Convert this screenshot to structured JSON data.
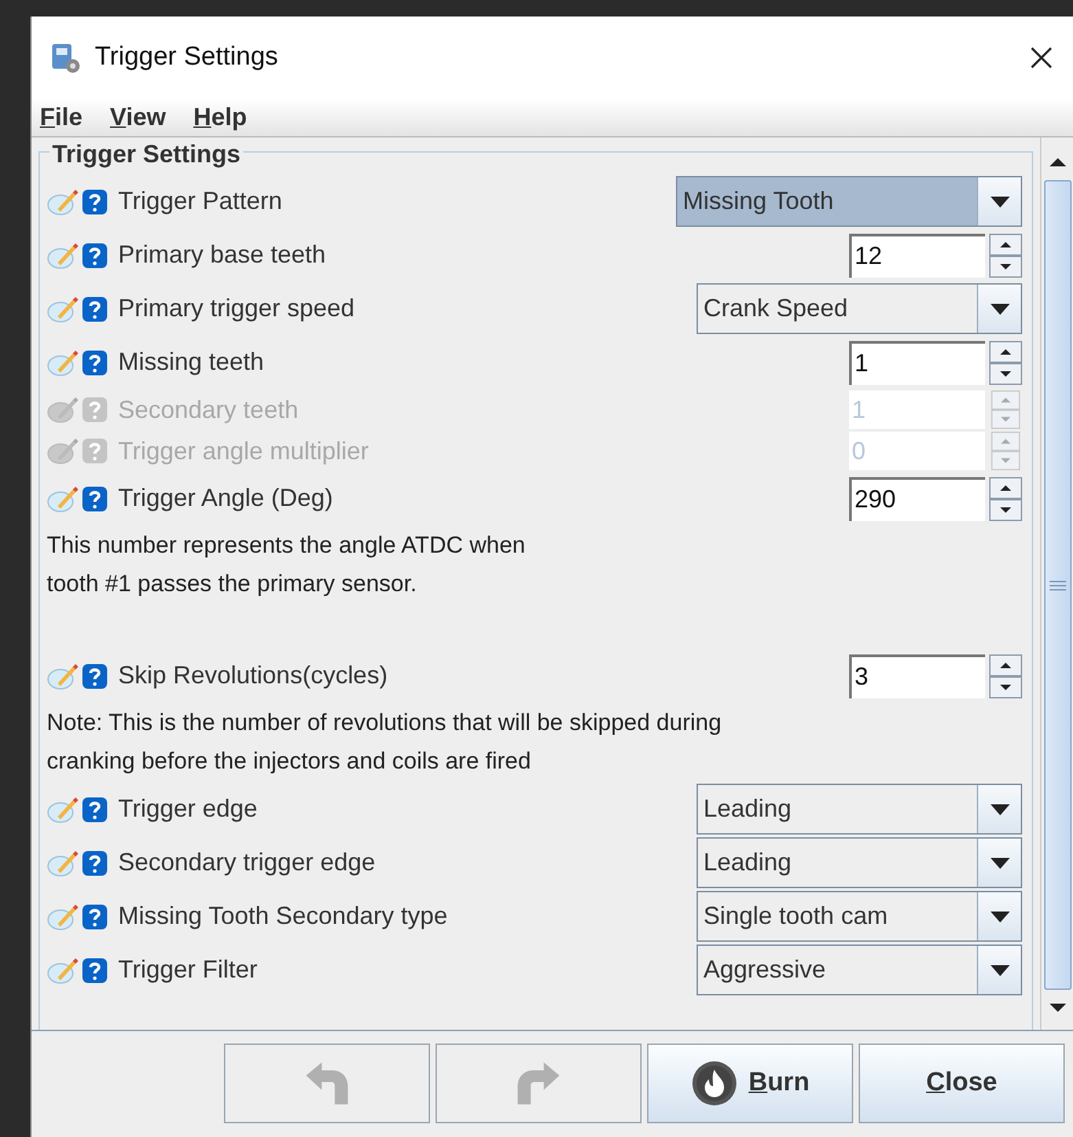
{
  "window": {
    "title": "Trigger Settings"
  },
  "menu": [
    "File",
    "View",
    "Help"
  ],
  "panel": {
    "title": "Trigger Settings",
    "rows": [
      {
        "kind": "combo",
        "label": "Trigger Pattern",
        "value": "Missing Tooth",
        "disabled": false,
        "focused": true
      },
      {
        "kind": "spinner",
        "label": "Primary base teeth",
        "value": "12",
        "disabled": false
      },
      {
        "kind": "combo",
        "label": "Primary trigger speed",
        "value": "Crank Speed",
        "disabled": false,
        "focused": false
      },
      {
        "kind": "spinner",
        "label": "Missing teeth",
        "value": "1",
        "disabled": false
      },
      {
        "kind": "spinner",
        "label": "Secondary teeth",
        "value": "1",
        "disabled": true
      },
      {
        "kind": "spinner",
        "label": "Trigger angle multiplier",
        "value": "0",
        "disabled": true
      },
      {
        "kind": "spinner",
        "label": "Trigger Angle (Deg)",
        "value": "290",
        "disabled": false
      },
      {
        "kind": "note",
        "lines": [
          "This number represents the angle ATDC when",
          "tooth #1 passes the primary sensor."
        ]
      },
      {
        "kind": "spacer"
      },
      {
        "kind": "spinner",
        "label": "Skip Revolutions(cycles)",
        "value": "3",
        "disabled": false
      },
      {
        "kind": "note",
        "lines": [
          "Note: This is the number of revolutions that will be skipped during",
          "cranking before the injectors and coils are fired"
        ]
      },
      {
        "kind": "combo",
        "label": "Trigger edge",
        "value": "Leading",
        "disabled": false,
        "focused": false
      },
      {
        "kind": "combo",
        "label": "Secondary trigger edge",
        "value": "Leading",
        "disabled": false,
        "focused": false
      },
      {
        "kind": "combo",
        "label": "Missing Tooth Secondary type",
        "value": "Single tooth cam",
        "disabled": false,
        "focused": false
      },
      {
        "kind": "combo",
        "label": "Trigger Filter",
        "value": "Aggressive",
        "disabled": false,
        "focused": false
      }
    ]
  },
  "buttons": [
    {
      "kind": "undo",
      "disabled": true
    },
    {
      "kind": "redo",
      "disabled": true
    },
    {
      "kind": "burn",
      "label": "Burn",
      "disabled": false
    },
    {
      "kind": "close",
      "label": "Close",
      "disabled": false
    }
  ]
}
